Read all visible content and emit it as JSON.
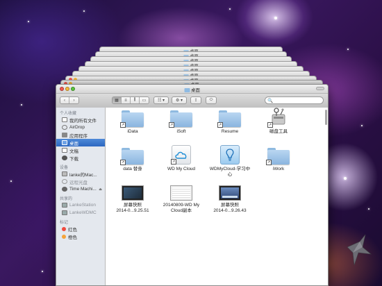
{
  "window": {
    "title": "桌面",
    "stacked_titles": [
      "桌面",
      "桌面",
      "桌面",
      "桌面",
      "桌面",
      "桌面",
      "桌面",
      "桌面"
    ]
  },
  "toolbar": {
    "nav_back": "‹",
    "nav_forward": "›",
    "view_icon": "▦",
    "view_list": "≡",
    "view_columns": "⫼",
    "view_coverflow": "▭",
    "arrange": "☷ ▾",
    "action": "⚙ ▾",
    "share": "⇪",
    "tag": "⬭",
    "search_icon": "🔍",
    "search_placeholder": ""
  },
  "sidebar": {
    "favorites_header": "个人收藏",
    "favorites": [
      {
        "label": "我的所有文件",
        "icon": "all-files-icon"
      },
      {
        "label": "AirDrop",
        "icon": "airdrop-icon"
      },
      {
        "label": "应用程序",
        "icon": "applications-icon"
      },
      {
        "label": "桌面",
        "icon": "desktop-icon",
        "selected": true
      },
      {
        "label": "文稿",
        "icon": "documents-icon"
      },
      {
        "label": "下载",
        "icon": "downloads-icon"
      }
    ],
    "devices_header": "设备",
    "devices": [
      {
        "label": "lanke的Mac...",
        "icon": "computer-icon"
      },
      {
        "label": "远程光盘",
        "icon": "remote-disc-icon"
      },
      {
        "label": "Time Machi...",
        "icon": "time-machine-icon",
        "eject": "⏏"
      }
    ],
    "shared_header": "共享的",
    "shared": [
      {
        "label": "LankeStation",
        "icon": "network-server-icon"
      },
      {
        "label": "LankeWDMC",
        "icon": "network-server-icon"
      }
    ],
    "tags_header": "标记",
    "tags": [
      {
        "label": "红色",
        "color": "#f04a3e"
      },
      {
        "label": "橙色",
        "color": "#f5a33a"
      }
    ]
  },
  "files": [
    {
      "label": "iData",
      "kind": "folder-alias"
    },
    {
      "label": "iSoft",
      "kind": "folder-alias"
    },
    {
      "label": "Resume",
      "kind": "folder-alias"
    },
    {
      "label": "磁盘工具",
      "kind": "disk-utility-alias"
    },
    {
      "label": "data 替身",
      "kind": "folder-alias"
    },
    {
      "label": "WD My Cloud",
      "kind": "wd-cloud-app"
    },
    {
      "label": "WDMyCloud-学习中\n心",
      "kind": "wd-learning-app"
    },
    {
      "label": "iWork",
      "kind": "folder-alias"
    },
    {
      "label": "屏幕快照\n2014-0...9.25.51",
      "kind": "screenshot"
    },
    {
      "label": "20140809-WD My\nCloud副本",
      "kind": "screenshot-doc"
    },
    {
      "label": "屏幕快照\n2014-0...9.26.43",
      "kind": "screenshot-mac"
    }
  ],
  "colors": {
    "selection": "#2c67c1",
    "folder": "#8ab5df"
  }
}
